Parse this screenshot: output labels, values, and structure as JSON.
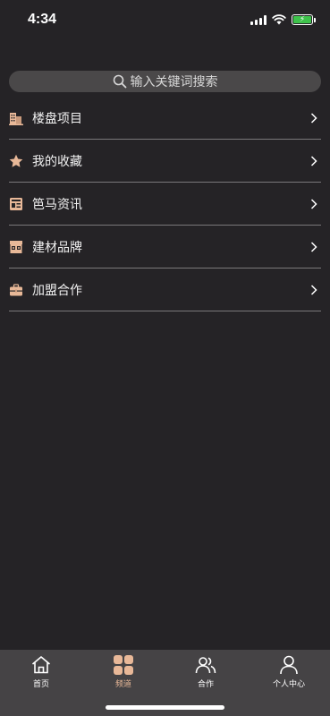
{
  "status_bar": {
    "time": "4:34"
  },
  "search": {
    "placeholder": "输入关键词搜索"
  },
  "menu": [
    {
      "label": "楼盘项目",
      "icon": "building-icon"
    },
    {
      "label": "我的收藏",
      "icon": "star-icon"
    },
    {
      "label": "笆马资讯",
      "icon": "news-icon"
    },
    {
      "label": "建材品牌",
      "icon": "storefront-icon"
    },
    {
      "label": "加盟合作",
      "icon": "briefcase-icon"
    }
  ],
  "tabbar": [
    {
      "label": "首页",
      "icon": "home-icon",
      "active": false
    },
    {
      "label": "频道",
      "icon": "grid-icon",
      "active": true
    },
    {
      "label": "合作",
      "icon": "partners-icon",
      "active": false
    },
    {
      "label": "个人中心",
      "icon": "profile-icon",
      "active": false
    }
  ],
  "colors": {
    "background": "#252326",
    "accent": "#e8b898",
    "tabbar_bg": "#454345",
    "search_bg": "#4a4849"
  }
}
